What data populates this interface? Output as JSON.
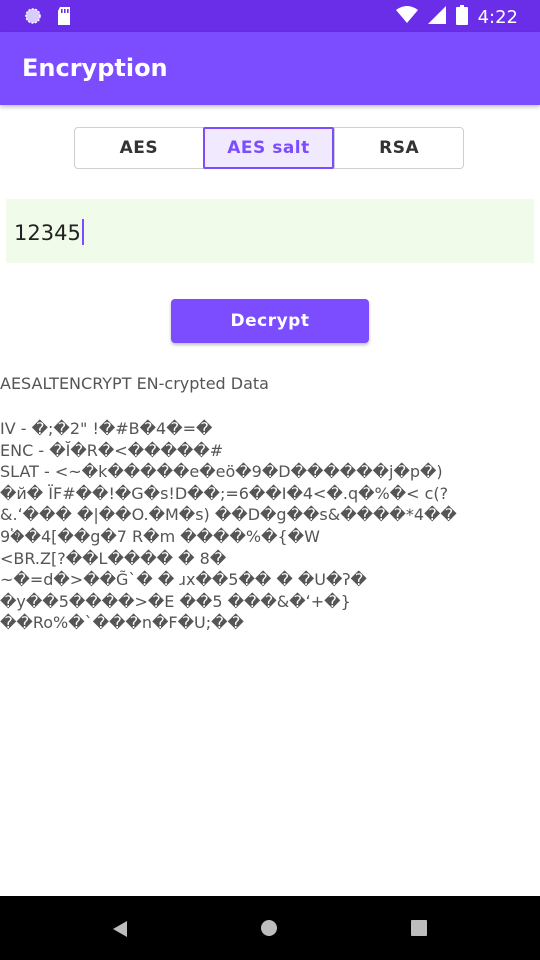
{
  "status_bar": {
    "time": "4:22"
  },
  "app_bar": {
    "title": "Encryption"
  },
  "tabs": [
    {
      "label": "AES",
      "selected": false
    },
    {
      "label": "AES salt",
      "selected": true
    },
    {
      "label": "RSA",
      "selected": false
    }
  ],
  "input": {
    "value": "12345"
  },
  "action": {
    "label": "Decrypt"
  },
  "output": {
    "title": "AESALTENCRYPT EN-crypted Data",
    "lines": [
      "IV - �;�2\" !�#B�4�=�",
      "ENC - �Ĭ�R�<�����#",
      "SLAT - <~�k�����e�eö�9�D������j�p�)",
      "�й� ÏF#��!�G�s!D��;=6��I�4<�.q�%�< c(?",
      "&.ʻ��� �|��O.�M�s) ��D�g��s&����*4��",
      "9�ٝ�4[��g�7 R�m ����%�{�W",
      "<BR.Z[?��L���� � 8�",
      "~�=d�>��G̃`� � ɹx��5�� � �U�ʔ�",
      "�y��5����>�E ��5 ���&�ʻ+�}",
      "��Ro%�`���n�F�U;��"
    ]
  },
  "colors": {
    "status_bar": "#6a2ee8",
    "primary": "#7c4dff",
    "input_background": "#f1fbe9",
    "selected_tab_background": "#f1eafe"
  },
  "icons": {
    "status_left": [
      "circle-notification-icon",
      "sd-card-icon"
    ],
    "status_right": [
      "wifi-icon",
      "signal-icon",
      "battery-icon"
    ],
    "navigation": [
      "back-icon",
      "home-icon",
      "recents-icon"
    ]
  }
}
